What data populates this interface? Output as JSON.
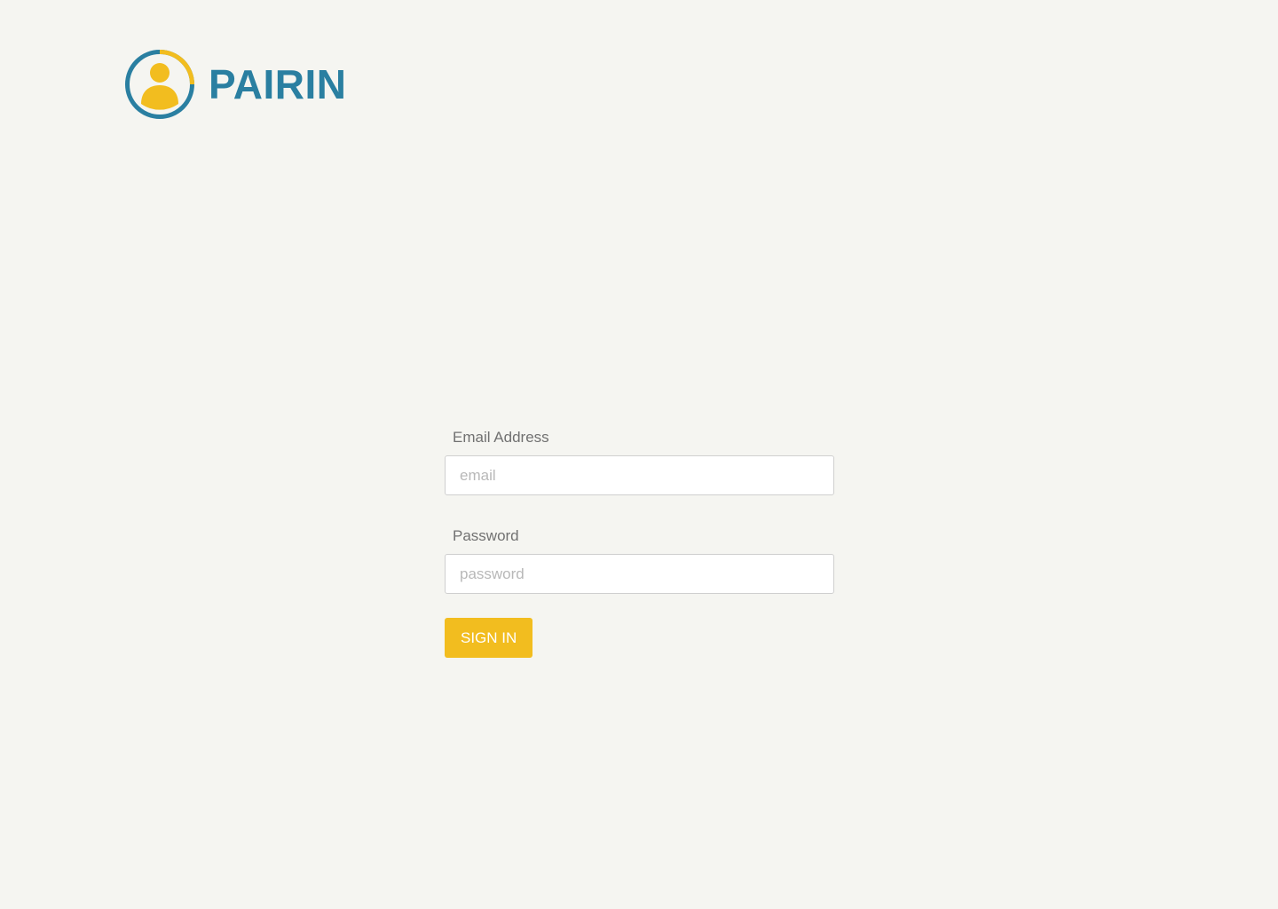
{
  "brand": {
    "name": "PAIRIN",
    "icon": "person-circle-logo-icon",
    "primary_color": "#2a7fa1",
    "accent_color": "#f2bd1f"
  },
  "login_form": {
    "email": {
      "label": "Email Address",
      "placeholder": "email",
      "value": ""
    },
    "password": {
      "label": "Password",
      "placeholder": "password",
      "value": ""
    },
    "submit_label": "SIGN IN"
  }
}
